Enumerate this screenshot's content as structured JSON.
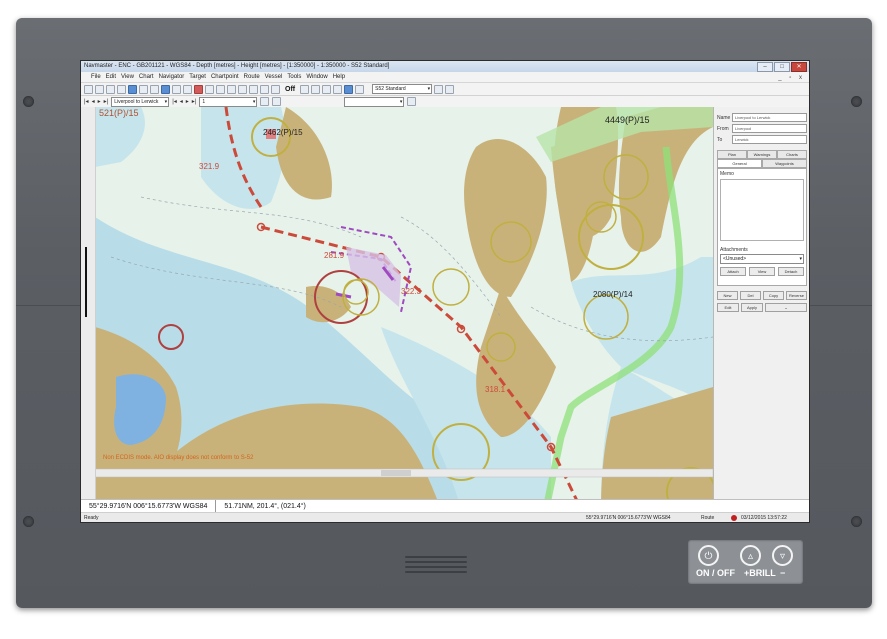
{
  "window": {
    "title": "Navmaster - ENC - GB201121 - WGS84 - Depth [metres] - Height [metres] - [1:350000] - 1:350000 - S52 Standard]",
    "min": "–",
    "max": "□",
    "close": "✕"
  },
  "menu": [
    "File",
    "Edit",
    "View",
    "Chart",
    "Navigator",
    "Target",
    "Chartpoint",
    "Route",
    "Vessel",
    "Tools",
    "Window",
    "Help"
  ],
  "toolbar": {
    "off_label": "Off",
    "display_combo": "S52 Standard"
  },
  "toolbar2": {
    "route_combo": "Liverpool to Lerwick",
    "page_combo": "1"
  },
  "chart": {
    "labels": {
      "range_tl": "521(P)/15",
      "ring_2462": "2462(P)/15",
      "ring_4449": "4449(P)/15",
      "ring_2080": "2080(P)/14",
      "bearing_321": "321.9",
      "bearing_281": "281.9",
      "bearing_322": "322.3",
      "bearing_318": "318.1"
    },
    "warning": "Non ECDIS mode. AIO display does not conform to S-52"
  },
  "panel": {
    "name_label": "Name",
    "name_value": "Liverpool to Lerwick",
    "from_label": "From",
    "from_value": "Liverpool",
    "to_label": "To",
    "to_value": "Lerwick",
    "tabs_top": [
      "Plan",
      "Warnings",
      "Charts"
    ],
    "tabs_bottom": [
      "General",
      "Waypoints"
    ],
    "memo_label": "Memo",
    "attachments_label": "Attachments",
    "attachments_value": "<Unused>",
    "attach_buttons": [
      "Attach",
      "View",
      "Detach"
    ],
    "route_buttons": [
      "New",
      "Del",
      "Copy",
      "Reverse"
    ],
    "edit_buttons": [
      "Edit",
      "Apply"
    ]
  },
  "cursor": {
    "position": "55°29.9716'N 006°15.6773'W WGS84",
    "range_bearing": "51.71NM, 201.4°, (021.4°)"
  },
  "status": {
    "left": "Ready",
    "position": "55°29.9716'N 006°15.6773'W WGS84",
    "mode": "Route",
    "datetime": "03/12/2015 13:57:22"
  },
  "hardware": {
    "power_label": "ON / OFF",
    "brill_plus": "+BRILL",
    "brill_minus": "−"
  },
  "colors": {
    "route": "#cc4a3a",
    "land": "#c9b27a",
    "shallow": "#b8dde8",
    "deep": "#e8f4ec"
  }
}
